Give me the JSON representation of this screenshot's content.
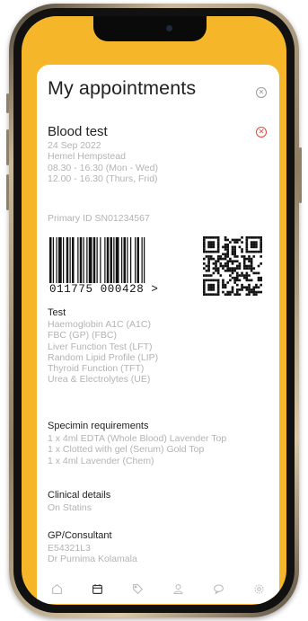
{
  "page": {
    "title": "My appointments"
  },
  "appointment": {
    "title": "Blood test",
    "date": "24 Sep 2022",
    "location": "Hemel Hempstead",
    "hours_1": "08.30 - 16.30 (Mon - Wed)",
    "hours_2": "12.00 - 16.30 (Thurs, Frid)",
    "primary_id": "Primary ID SN01234567",
    "barcode_text": "011775 000428 >"
  },
  "sections": {
    "test": {
      "heading": "Test",
      "items": [
        "Haemoglobin A1C (A1C)",
        "FBC (GP) (FBC)",
        "Liver Function Test (LFT)",
        "Random Lipid Profile (LIP)",
        "Thyroid Function (TFT)",
        "Urea & Electrolytes (UE)"
      ]
    },
    "specimen": {
      "heading": "Specimin requirements",
      "items": [
        "1 x 4ml EDTA (Whole Blood) Lavender Top",
        "1 x Clotted with gel (Serum) Gold Top",
        "1 x 4ml Lavender (Chem)"
      ]
    },
    "clinical": {
      "heading": "Clinical details",
      "items": [
        "On Statins"
      ]
    },
    "gp": {
      "heading": "GP/Consultant",
      "items": [
        "E54321L3",
        "Dr Purnima Kolamala"
      ]
    }
  },
  "tabs": [
    {
      "icon": "home-icon"
    },
    {
      "icon": "calendar-icon"
    },
    {
      "icon": "tag-icon"
    },
    {
      "icon": "user-icon"
    },
    {
      "icon": "chat-icon"
    },
    {
      "icon": "settings-icon"
    }
  ],
  "colors": {
    "accent": "#f6b62a",
    "danger": "#e8433a",
    "active_tab": "#333333",
    "inactive_tab": "#b5b5b5"
  }
}
